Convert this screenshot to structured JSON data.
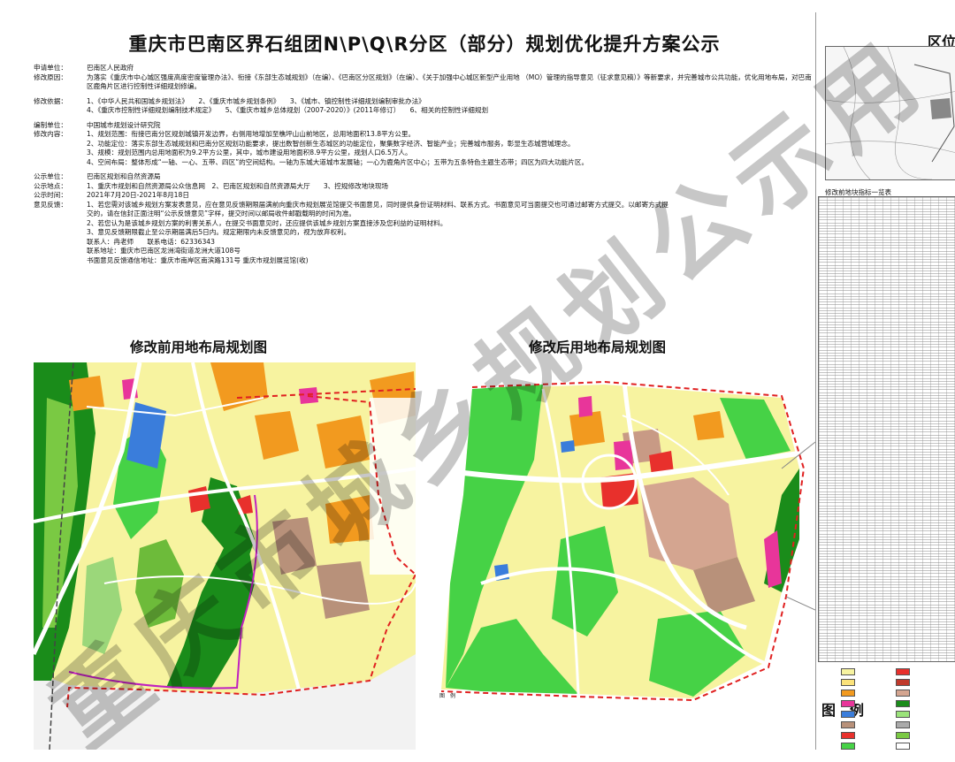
{
  "title": "重庆市巴南区界石组团N\\P\\Q\\R分区（部分）规划优化提升方案公示",
  "info": {
    "applicant_label": "申请单位：",
    "applicant": "巴南区人民政府",
    "reason_label": "修改原因：",
    "reason": "为落实《重庆市中心城区强度高度密度管理办法》、衔接《东部生态城规划》（在编）、《巴南区分区规划》（在编）、《关于加强中心城区新型产业用地 （MO）管理的指导意见（征求意见稿）》等新要求，并完善城市公共功能，优化用地布局，对巴南区鹿角片区进行控制性详细规划修编。",
    "basis_label": "修改依据：",
    "basis_line1": "1、《中华人民共和国城乡规划法》　　2、《重庆市城乡规划条例》　　3、《城市、镇控制性详细规划编制审批办法》",
    "basis_line2": "4、《重庆市控制性详细规划编制技术规定》　　5、《重庆市城乡总体规划（2007-2020）》(2011年修订）　　6、相关的控制性详细规划",
    "designer_label": "编制单位：",
    "designer": "中国城市规划设计研究院",
    "content_label": "修改内容：",
    "content_1": "1、规划范围：衔接巴南分区规划城镇开发边界，右侧用地增加至樵坪山山前地区，总用地面积13.8平方公里。",
    "content_2": "2、功能定位：落实东部生态城规划和巴南分区规划功能要求，提出数智创新生态城区的功能定位，聚集数字经济、智能产业；完善城市服务，彰显生态城营城理念。",
    "content_3": "3、规模：规划范围内总用地面积为9.2平方公里，其中，城市建设用地面积8.9平方公里，规划人口6.5万人。",
    "content_4": "4、空间布局：整体形成“一轴、一心、五带、四区”的空间结构。一轴为东城大道城市发展轴；一心为鹿角片区中心；五带为五条特色主题生态带；四区为四大功能片区。",
    "publisher_label": "公示单位：",
    "publisher": "巴南区规划和自然资源局",
    "place_label": "公示地点：",
    "place": "1、重庆市规划和自然资源局公众信息网　2、巴南区规划和自然资源局大厅　　3、控规修改地块现场",
    "time_label": "公示时间：",
    "time": "2021年7月20日-2021年8月18日",
    "feedback_label": "意见反馈：",
    "feedback_1a": "1、若您需对该城乡规划方案发表意见，应在意见反馈期限届满前向重庆市规划展览馆提交书面意见，同时提供身份证明材料、联系方式。书面意见可当面提交也可通过邮寄方式提交。以邮寄方式提",
    "feedback_1b": "交的，请在信封正面注明“公示反馈意见”字样，提交时间以邮局收件邮戳载明的时间为准。",
    "feedback_2": "2、若您认为是该城乡规划方案的利害关系人，在提交书面意见时，还应提供该城乡规划方案直接涉及您利益的证明材料。",
    "feedback_3": "3、意见反馈期限截止至公示期届满后5日内。规定期限内未反馈意见的，视为放弃权利。",
    "contact": "联系人：冉老师　　联系电话：62336343",
    "address": "联系地址：重庆市巴南区龙洲湾街道龙洲大道108号",
    "mail": "书面意见反馈通信地址：重庆市南岸区南滨路131号 重庆市规划展览馆(收)"
  },
  "maps": {
    "before_title": "修改前用地布局规划图",
    "after_title": "修改后用地布局规划图",
    "after_legend_tag": "图　例"
  },
  "side": {
    "title": "区位",
    "table_title": "修改前地块指标一览表",
    "legend_title": "图　例"
  },
  "watermark": "重庆市城乡规划公示用",
  "colors": {
    "residential": "#f7f3a0",
    "residential_b": "#fbe27a",
    "commercial": "#e8302c",
    "industrial": "#b8917a",
    "green_dark": "#1a8c1a",
    "green": "#46d246",
    "green_light": "#9be37a",
    "orange": "#f29a1f",
    "magenta": "#e8359a",
    "blue": "#3a7ddb",
    "road": "#ffffff",
    "boundary": "#e02020"
  }
}
